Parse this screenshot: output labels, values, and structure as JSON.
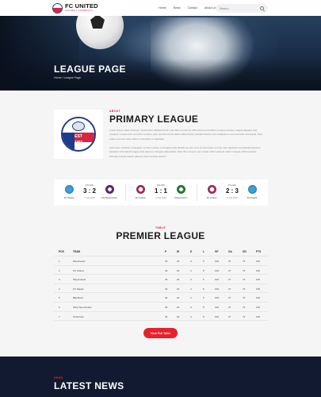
{
  "header": {
    "logo_title": "FC UNITED",
    "logo_subtitle": "FOOTBALL COMMUNITY",
    "nav": [
      "Home",
      "News",
      "Contact",
      "About Us"
    ],
    "search_placeholder": "Search..."
  },
  "hero": {
    "title": "LEAGUE PAGE",
    "breadcrumb": "Home / League Page"
  },
  "about": {
    "kicker": "ABOUT",
    "title": "PRIMARY LEAGUE",
    "emblem_text": "EST",
    "emblem_year": "1987",
    "paragraph1": "Lorem ipsum dolor sit amet, consectetur adipiscing elit, sed diam nonummy nibh euismod tincidunt ut laoreet dolore magna aliquam erat volutpat. Ut wisi enim ad minim veniam, quis nostrud exerci tation ullamcorper suscipit lobortis nisl ut aliquip ex ea commodo consequat. Duis autem vel eum iriure dolor in hendrerit in vulputate.",
    "paragraph2": "Velit esse molestie consequat, vel illum dolore eu feugiat nulla facilisis at vero eros et accumsan et iusto odio dignissim qui blandit praesent luptatum zzril delenit augue duis dolore te feugait nulla facilisi. Nam liber tempor cum soluta nobis eleifend option congue nihil imperdiet doming id quod mazim placerat facer possim assum."
  },
  "results": [
    {
      "label": "Friendly",
      "home": "FC Napoli",
      "away": "FG Moscovians",
      "score": "3 : 2",
      "date": "7 July 2016",
      "home_crest": "crest-blue",
      "away_crest": "crest-purple"
    },
    {
      "label": "Friendly",
      "home": "FC United",
      "away": "Playerswind",
      "score": "1 : 1",
      "date": "5 July 2016",
      "home_crest": "crest-red",
      "away_crest": "crest-green"
    },
    {
      "label": "Friendly",
      "home": "FC United",
      "away": "FC Napoli",
      "score": "2 : 3",
      "date": "3 July 2016",
      "home_crest": "crest-red",
      "away_crest": "crest-blue"
    }
  ],
  "table": {
    "kicker": "TABLE",
    "title": "PREMIER LEAGUE",
    "columns": [
      "POS",
      "TEAM",
      "P",
      "W",
      "D",
      "L",
      "GF",
      "GA",
      "GD",
      "PTS"
    ],
    "rows": [
      [
        "1",
        "Manchester",
        "33",
        "22",
        "4",
        "5",
        "100",
        "27",
        "73",
        "106"
      ],
      [
        "2",
        "FC United",
        "33",
        "22",
        "4",
        "5",
        "100",
        "27",
        "73",
        "106"
      ],
      [
        "3",
        "Playerswind",
        "33",
        "22",
        "4",
        "5",
        "100",
        "27",
        "73",
        "106"
      ],
      [
        "4",
        "FC Napoli",
        "33",
        "22",
        "4",
        "5",
        "100",
        "27",
        "73",
        "106"
      ],
      [
        "5",
        "Blackburn",
        "33",
        "22",
        "4",
        "5",
        "100",
        "27",
        "73",
        "106"
      ],
      [
        "6",
        "West Sporchester",
        "33",
        "22",
        "4",
        "5",
        "100",
        "27",
        "73",
        "106"
      ],
      [
        "7",
        "Tottenham",
        "33",
        "22",
        "4",
        "5",
        "100",
        "27",
        "73",
        "106"
      ]
    ],
    "button": "View Full Table"
  },
  "news": {
    "kicker": "NEWS",
    "title": "LATEST NEWS"
  },
  "colors": {
    "accent": "#e8202c",
    "navy": "#111a30",
    "brand_blue": "#1e3a8a"
  }
}
